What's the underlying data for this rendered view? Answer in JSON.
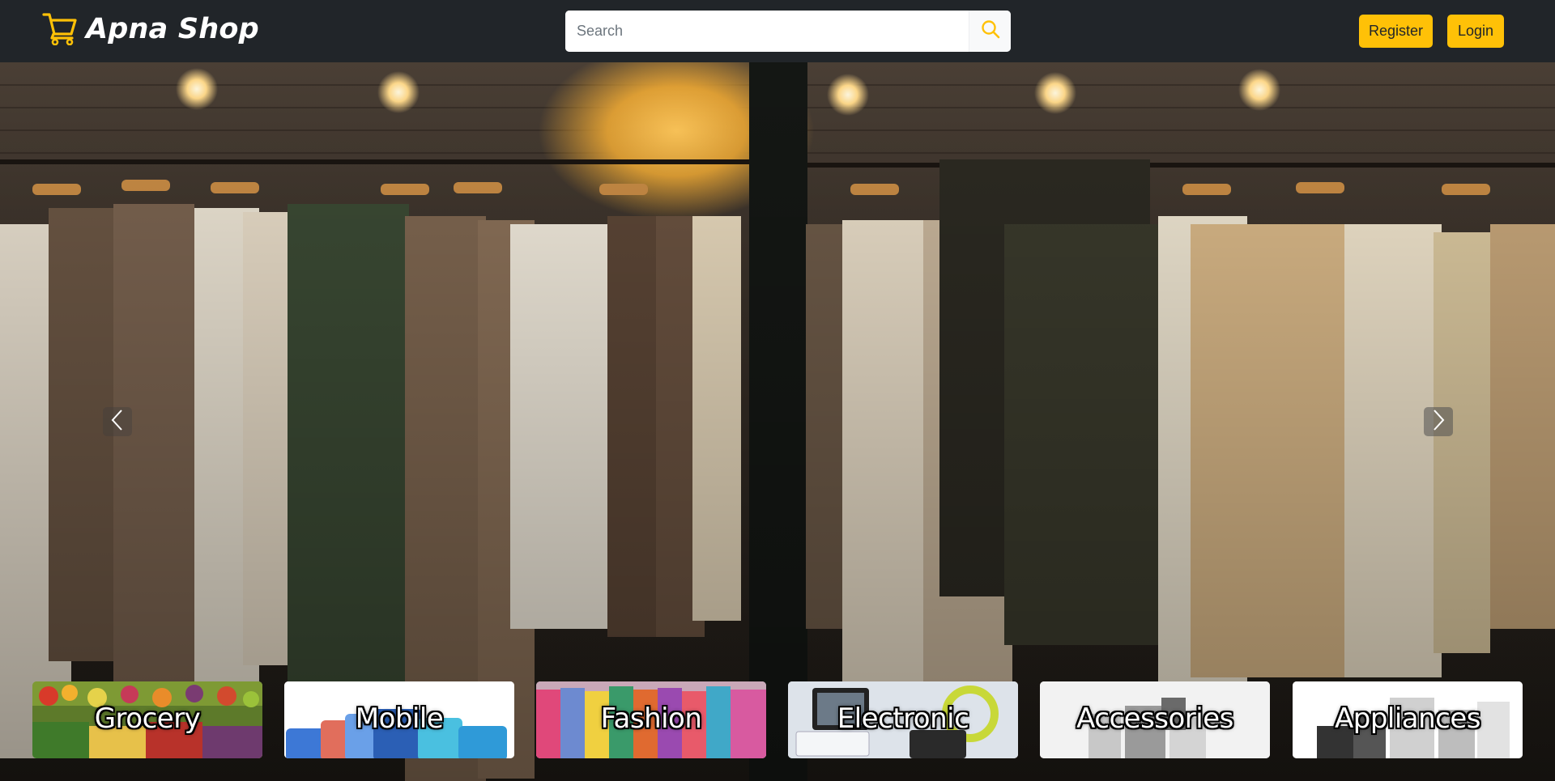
{
  "app": {
    "brand_name": "Apna Shop",
    "brand_icon": "shopping-cart-icon",
    "accent_color": "#ffc107",
    "nav_bg_color": "#212529"
  },
  "search": {
    "placeholder": "Search",
    "value": "",
    "button_icon": "search-icon"
  },
  "auth": {
    "register_label": "Register",
    "login_label": "Login"
  },
  "carousel": {
    "prev_icon": "chevron-left-icon",
    "next_icon": "chevron-right-icon"
  },
  "categories": [
    {
      "label": "Grocery"
    },
    {
      "label": "Mobile"
    },
    {
      "label": "Fashion"
    },
    {
      "label": "Electronic"
    },
    {
      "label": "Accessories"
    },
    {
      "label": "Appliances"
    }
  ]
}
